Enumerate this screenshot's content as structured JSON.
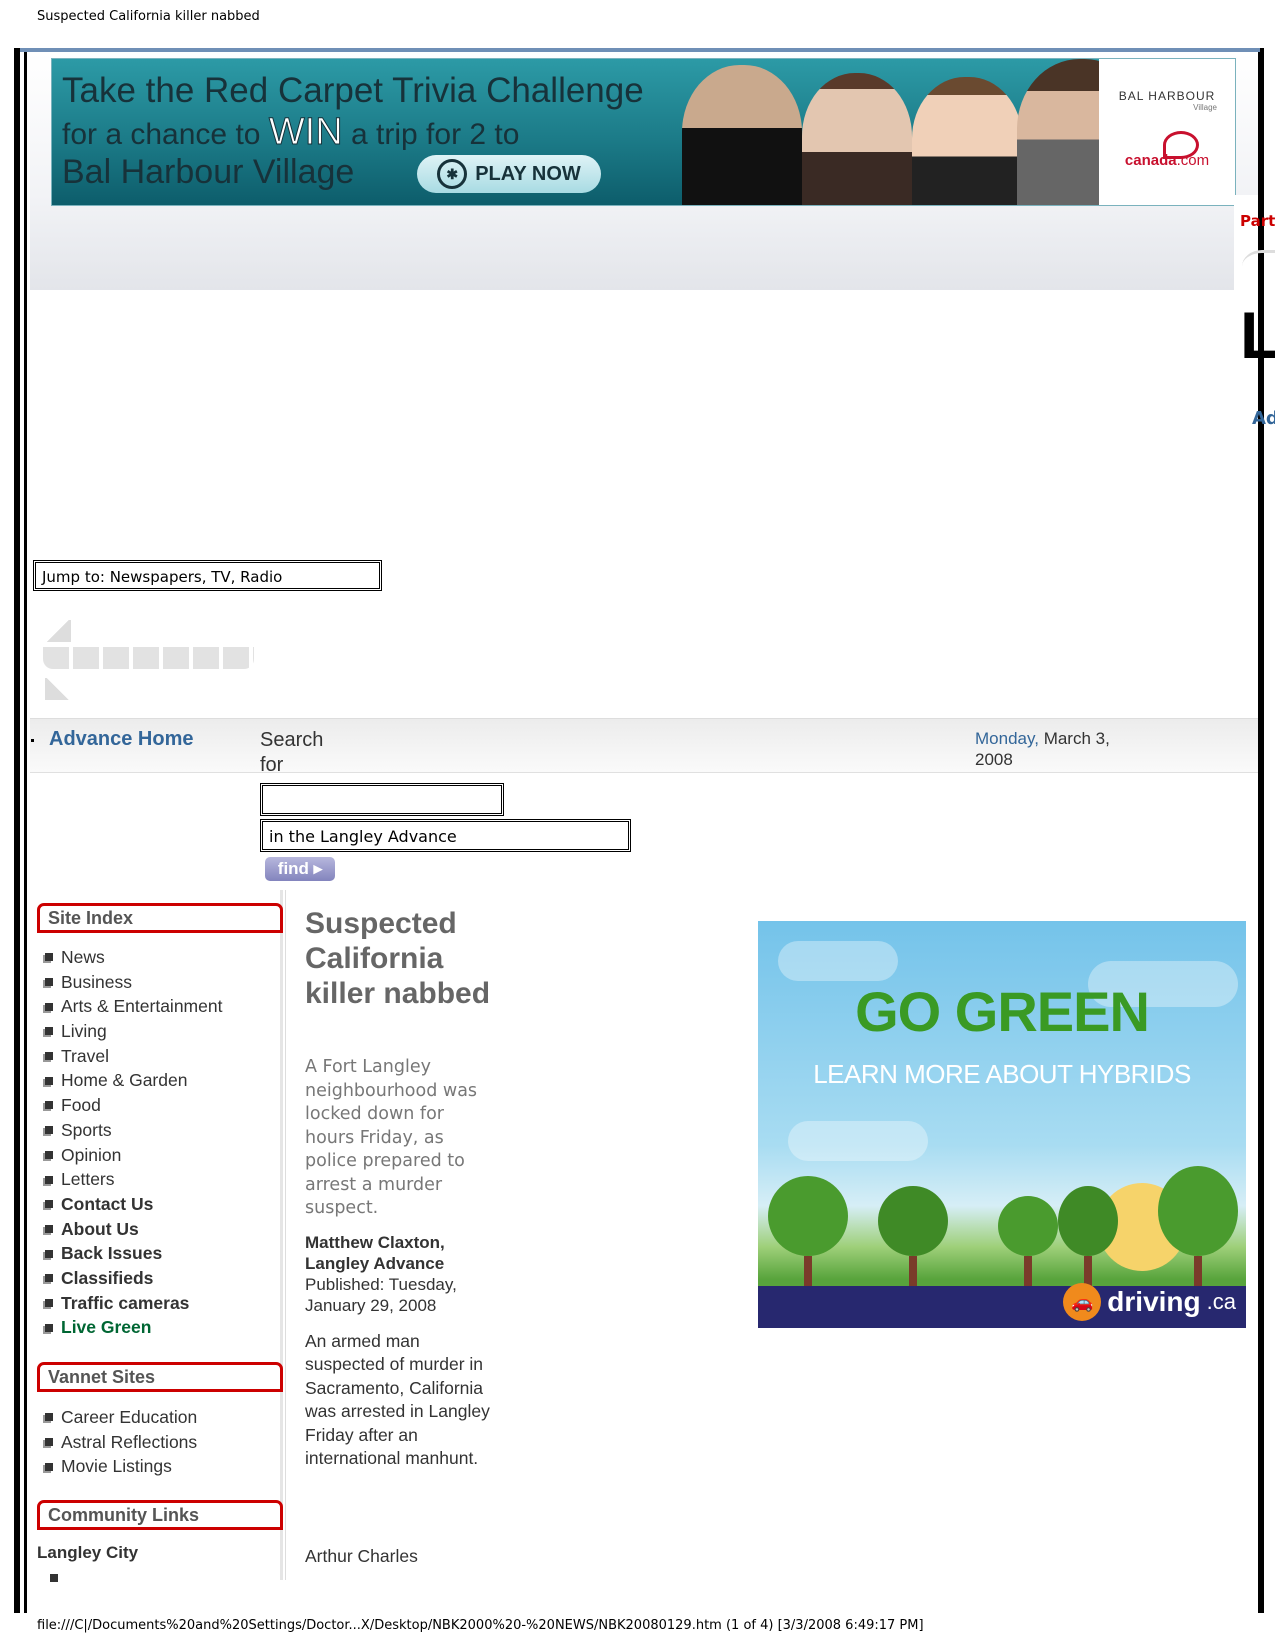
{
  "window": {
    "title": "Suspected California killer nabbed",
    "footer_path": "file:///C|/Documents%20and%20Settings/Doctor...X/Desktop/NBK2000%20-%20NEWS/NBK20080129.htm (1 of 4) [3/3/2008 6:49:17 PM]"
  },
  "banner": {
    "line1": "Take the Red Carpet Trivia Challenge",
    "line2_a": "for a chance to",
    "line2_win": "WIN",
    "line2_b": "a trip for 2 to",
    "line3": "Bal Harbour Village",
    "play_label": "PLAY NOW",
    "sponsor": "BAL HARBOUR",
    "sponsor_sub": "Village",
    "brand": "canada",
    "brand_tld": ".com"
  },
  "header_right": {
    "part_text": "Part",
    "big_letter": "La",
    "ad_text": "Ad"
  },
  "jump": {
    "label": "Jump to: Newspapers, TV, Radio"
  },
  "nav": {
    "home_label": "Advance Home",
    "search_label": "Search for",
    "search_value": "",
    "search_scope": "in the Langley Advance",
    "find_label": "find ▸",
    "date_day": "Monday,",
    "date_rest": "March 3, 2008"
  },
  "sidebar": {
    "site_index_title": "Site Index",
    "site_index": [
      {
        "label": "News",
        "style": "normal"
      },
      {
        "label": "Business",
        "style": "normal"
      },
      {
        "label": "Arts & Entertainment",
        "style": "normal"
      },
      {
        "label": "Living",
        "style": "normal"
      },
      {
        "label": "Travel",
        "style": "normal"
      },
      {
        "label": "Home & Garden",
        "style": "normal"
      },
      {
        "label": "Food",
        "style": "normal"
      },
      {
        "label": "Sports",
        "style": "normal"
      },
      {
        "label": "Opinion",
        "style": "normal"
      },
      {
        "label": "Letters",
        "style": "normal"
      },
      {
        "label": "Contact Us",
        "style": "bold"
      },
      {
        "label": "About Us",
        "style": "bold"
      },
      {
        "label": "Back Issues",
        "style": "bold"
      },
      {
        "label": "Classifieds",
        "style": "bold"
      },
      {
        "label": "Traffic cameras",
        "style": "bold"
      },
      {
        "label": "Live Green",
        "style": "green"
      }
    ],
    "vannet_title": "Vannet Sites",
    "vannet": [
      {
        "label": "Career Education"
      },
      {
        "label": "Astral Reflections"
      },
      {
        "label": "Movie Listings"
      }
    ],
    "community_title": "Community Links",
    "community_first": "Langley City"
  },
  "article": {
    "title": "Suspected California killer nabbed",
    "deck": "A Fort Langley neighbourhood was locked down for hours Friday, as police prepared to arrest a murder suspect.",
    "author": "Matthew Claxton, Langley Advance",
    "published": "Published: Tuesday, January 29, 2008",
    "body_p1": "An armed man suspected of murder in Sacramento, California was arrested in Langley Friday after an international manhunt.",
    "body_p2": "Arthur Charles"
  },
  "green_ad": {
    "headline": "GO GREEN",
    "sub": "LEARN MORE ABOUT HYBRIDS",
    "logo": "driving",
    "logo_tld": ".ca"
  }
}
